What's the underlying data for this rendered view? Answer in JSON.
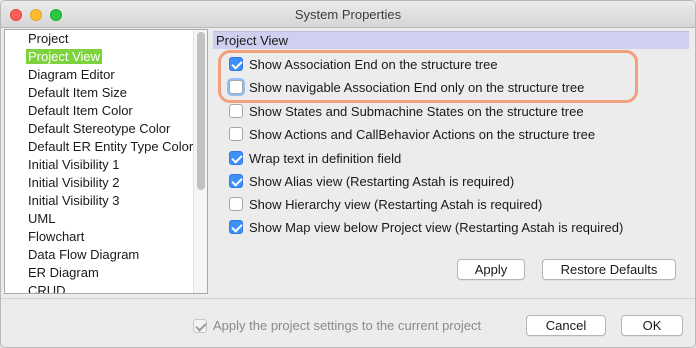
{
  "window": {
    "title": "System Properties"
  },
  "sidebar": {
    "items": [
      {
        "label": "Project",
        "selected": false
      },
      {
        "label": "Project View",
        "selected": true
      },
      {
        "label": "Diagram Editor",
        "selected": false
      },
      {
        "label": "Default Item Size",
        "selected": false
      },
      {
        "label": "Default Item Color",
        "selected": false
      },
      {
        "label": "Default Stereotype Color",
        "selected": false
      },
      {
        "label": "Default ER Entity Type Color",
        "selected": false
      },
      {
        "label": "Initial Visibility 1",
        "selected": false
      },
      {
        "label": "Initial Visibility 2",
        "selected": false
      },
      {
        "label": "Initial Visibility 3",
        "selected": false
      },
      {
        "label": "UML",
        "selected": false
      },
      {
        "label": "Flowchart",
        "selected": false
      },
      {
        "label": "Data Flow Diagram",
        "selected": false
      },
      {
        "label": "ER Diagram",
        "selected": false
      },
      {
        "label": "CRUD",
        "selected": false
      }
    ]
  },
  "panel": {
    "header": "Project View",
    "options": [
      {
        "label": "Show Association End on the structure tree",
        "checked": true
      },
      {
        "label": "Show navigable Association End only on the structure tree",
        "checked": false
      },
      {
        "label": "Show States and Submachine States on the structure tree",
        "checked": false
      },
      {
        "label": "Show Actions and CallBehavior Actions on the structure tree",
        "checked": false
      },
      {
        "label": "Wrap text in definition field",
        "checked": true
      },
      {
        "label": "Show Alias view (Restarting Astah is required)",
        "checked": true
      },
      {
        "label": "Show Hierarchy view (Restarting Astah is required)",
        "checked": false
      },
      {
        "label": "Show Map view below Project view (Restarting Astah is required)",
        "checked": true
      }
    ],
    "apply_label": "Apply",
    "restore_label": "Restore Defaults"
  },
  "footer": {
    "apply_project_label": "Apply the project settings to the current project",
    "apply_project_checked": true,
    "cancel_label": "Cancel",
    "ok_label": "OK"
  },
  "colors": {
    "selection": "#7cd33e",
    "checkbox_checked": "#3e8ff7",
    "header_bg": "#cfcff0",
    "highlight": "#f0a07c"
  }
}
